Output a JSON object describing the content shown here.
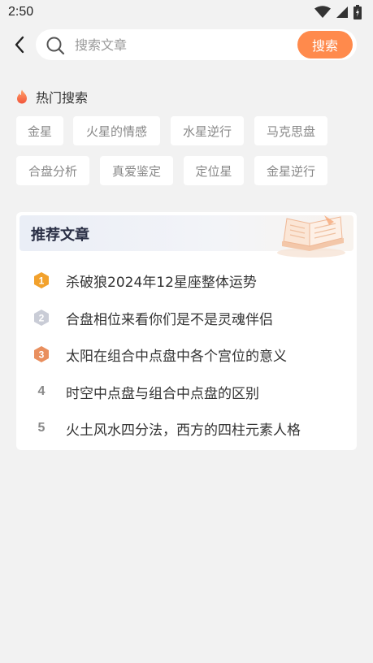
{
  "status_bar": {
    "time": "2:50"
  },
  "search": {
    "placeholder": "搜索文章",
    "button_label": "搜索"
  },
  "hot_search": {
    "title": "热门搜索",
    "tags": [
      "金星",
      "火星的情感",
      "水星逆行",
      "马克思盘",
      "合盘分析",
      "真爱鉴定",
      "定位星",
      "金星逆行"
    ]
  },
  "recommended": {
    "title": "推荐文章",
    "items": [
      {
        "rank": "1",
        "text": "杀破狼2024年12星座整体运势"
      },
      {
        "rank": "2",
        "text": "合盘相位来看你们是不是灵魂伴侣"
      },
      {
        "rank": "3",
        "text": "太阳在组合中点盘中各个宫位的意义"
      },
      {
        "rank": "4",
        "text": "时空中点盘与组合中点盘的区别"
      },
      {
        "rank": "5",
        "text": "火土风水四分法，西方的四柱元素人格"
      }
    ]
  },
  "colors": {
    "accent": "#ff8a4c",
    "background": "#f2f2f2",
    "rank_gold": "#f2a12c",
    "rank_silver": "#c9ccd6",
    "rank_bronze": "#e98f5e"
  },
  "icons": {
    "back": "chevron-left-icon",
    "search": "search-icon",
    "hot": "flame-icon",
    "header_decoration": "book-icon"
  }
}
